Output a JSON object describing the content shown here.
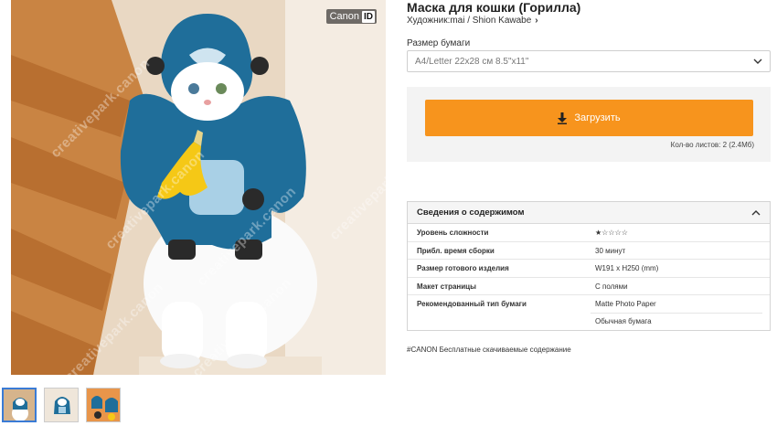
{
  "photo": {
    "badge_brand": "Canon",
    "badge_id": "ID",
    "watermark": "creativepark.canon"
  },
  "thumbnails": [
    {
      "name": "thumb-1",
      "active": true
    },
    {
      "name": "thumb-2",
      "active": false
    },
    {
      "name": "thumb-3",
      "active": false
    }
  ],
  "product": {
    "title": "Маска для кошки (Горилла)",
    "artist": "Художник:mai / Shion Kawabe",
    "artist_chevron": "›"
  },
  "paper": {
    "label": "Размер бумаги",
    "selected": "A4/Letter 22x28 см 8.5\"x11\""
  },
  "download": {
    "button_label": "Загрузить",
    "sheets": "Кол-во листов: 2 (2.4Мб)",
    "accent": "#f7941d"
  },
  "details": {
    "heading": "Сведения о содержимом",
    "rows": [
      {
        "key": "Уровень сложности",
        "value": "★☆☆☆☆"
      },
      {
        "key": "Прибл. время сборки",
        "value": "30 минут"
      },
      {
        "key": "Размер готового изделия",
        "value": "W191 x H250 (mm)"
      },
      {
        "key": "Макет страницы",
        "value": "С полями"
      },
      {
        "key": "Рекомендованный тип бумаги",
        "value": "Matte Photo Paper",
        "value2": "Обычная бумага"
      }
    ]
  },
  "footer_tag": "#CANON Бесплатные скачиваемые содержание"
}
